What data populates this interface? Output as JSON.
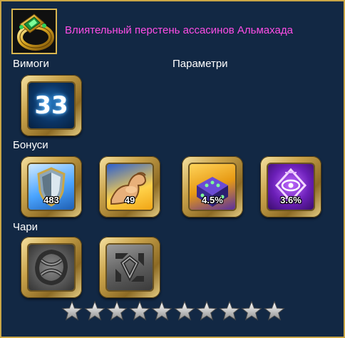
{
  "item": {
    "title": "Влиятельный перстень ассасинов Альмахада",
    "icon": "gold-ring-with-green-gems-icon"
  },
  "sections": {
    "requirements_label": "Вимоги",
    "parameters_label": "Параметри",
    "bonuses_label": "Бонуси",
    "charms_label": "Чари"
  },
  "requirements": {
    "level": "33"
  },
  "bonuses": [
    {
      "icon": "shield-icon",
      "value": "483"
    },
    {
      "icon": "flexed-arm-icon",
      "value": "49"
    },
    {
      "icon": "purple-dice-icon",
      "value": "4.5%"
    },
    {
      "icon": "purple-eye-rune-icon",
      "value": "3.6%"
    }
  ],
  "charms": [
    {
      "icon": "stone-knot-charm-icon"
    },
    {
      "icon": "stone-rune-charm-icon"
    }
  ],
  "rating": {
    "stars": 10,
    "filled": 10
  },
  "colors": {
    "background": "#122844",
    "border": "#c9a646",
    "title": "#ff4de6",
    "label": "#ffffff"
  }
}
